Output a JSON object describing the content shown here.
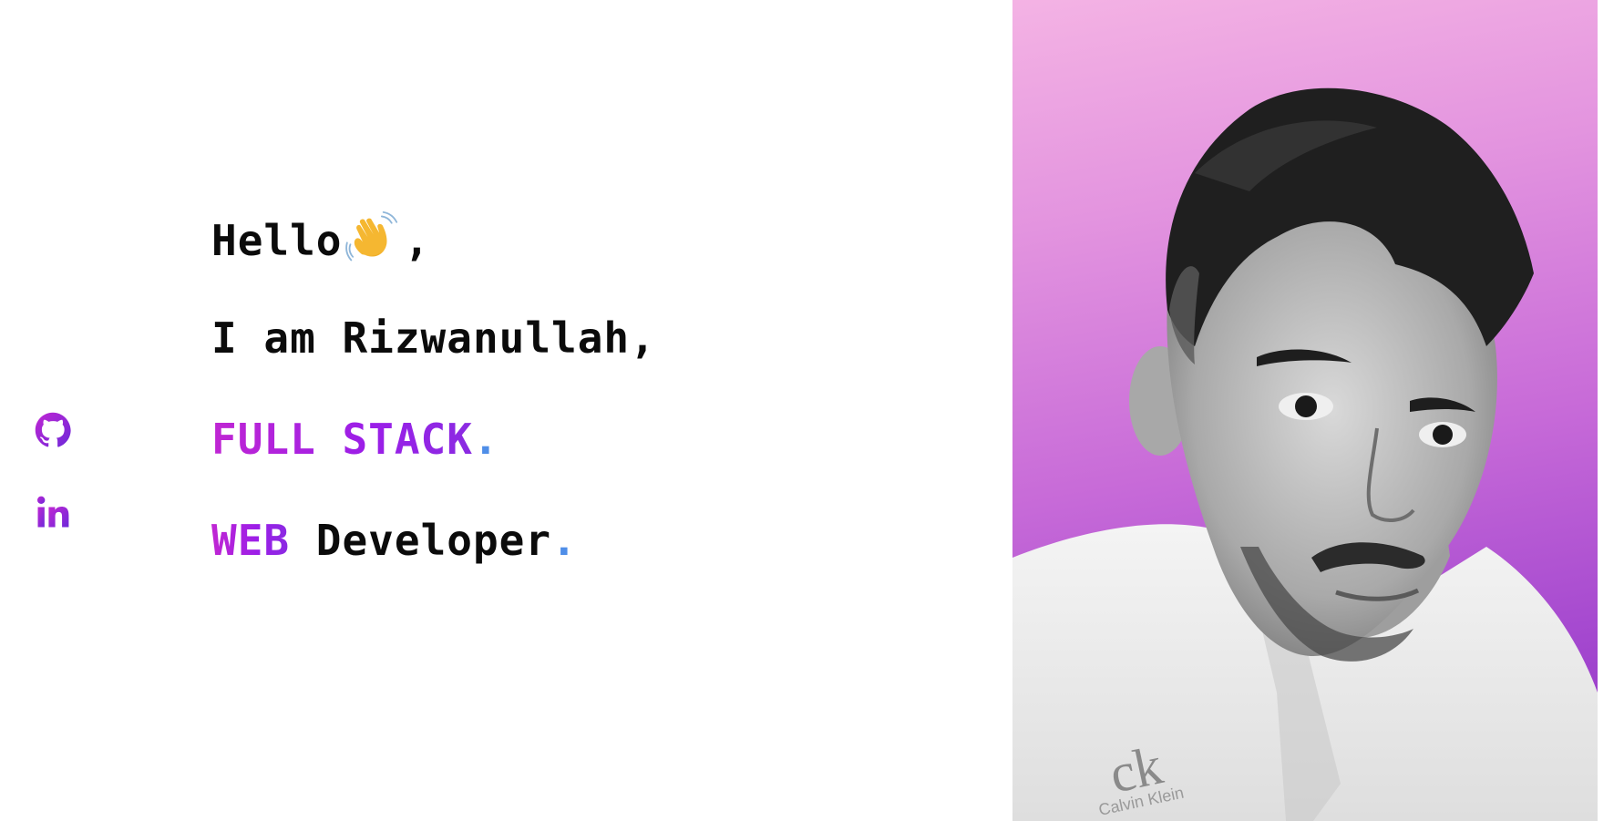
{
  "intro": {
    "greeting": "Hello",
    "greeting_suffix": ",",
    "wave_emoji": "waving-hand-icon",
    "line2": "I am Rizwanullah,",
    "line3_highlight": "FULL STACK",
    "line3_dot": ".",
    "line4_highlight": "WEB",
    "line4_text": " Developer",
    "line4_dot": "."
  },
  "social": {
    "items": [
      {
        "icon": "github-icon"
      },
      {
        "icon": "linkedin-icon"
      }
    ]
  },
  "colors": {
    "accent_start": "#c026d3",
    "accent_end": "#8a2be2",
    "dot": "#4f8ee8",
    "text": "#0b0b0b",
    "portrait_bg_top": "#f4b3e4",
    "portrait_bg_bottom": "#8c2fc4"
  }
}
